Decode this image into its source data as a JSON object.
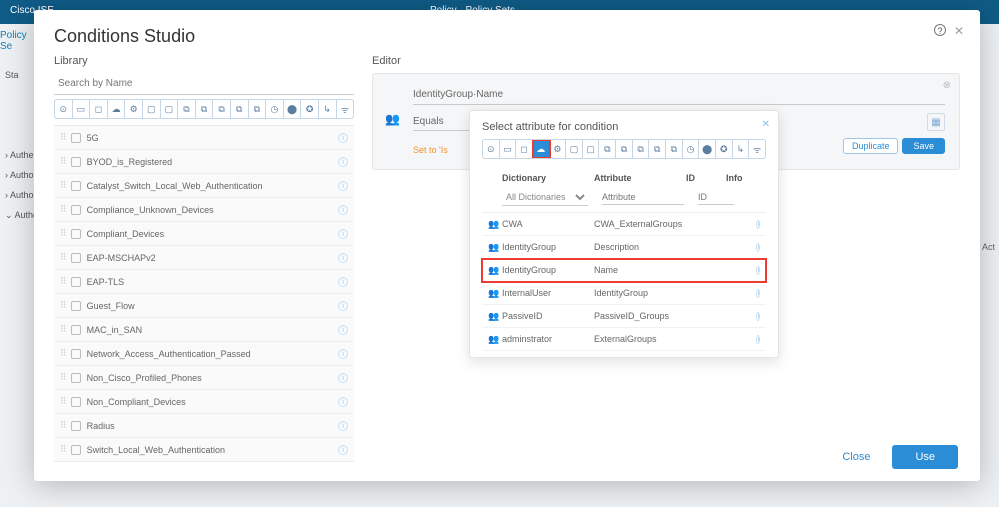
{
  "background": {
    "app": "Cisco ISE",
    "breadcrumb": "Policy · Policy Sets",
    "policy_sets_label": "Policy Se",
    "side_items": [
      "Authe",
      "Autho",
      "Autho",
      "Authori"
    ],
    "status_label": "Sta",
    "actions_label": "Act"
  },
  "modal": {
    "title": "Conditions Studio",
    "help_tooltip": "?",
    "library_label": "Library",
    "editor_label": "Editor",
    "search_placeholder": "Search by Name",
    "close_label": "Close",
    "use_label": "Use"
  },
  "icon_filters": [
    "⊙",
    "▭",
    "◻",
    "☁",
    "⚙",
    "▢",
    "▢",
    "⧉",
    "⧉",
    "⧉",
    "⧉",
    "⧉",
    "◷",
    "⬤",
    "✪",
    "↳",
    "ᯤ"
  ],
  "library_items": [
    {
      "name": "5G"
    },
    {
      "name": "BYOD_is_Registered"
    },
    {
      "name": "Catalyst_Switch_Local_Web_Authentication"
    },
    {
      "name": "Compliance_Unknown_Devices"
    },
    {
      "name": "Compliant_Devices"
    },
    {
      "name": "EAP-MSCHAPv2"
    },
    {
      "name": "EAP-TLS"
    },
    {
      "name": "Guest_Flow"
    },
    {
      "name": "MAC_in_SAN"
    },
    {
      "name": "Network_Access_Authentication_Passed"
    },
    {
      "name": "Non_Cisco_Profiled_Phones"
    },
    {
      "name": "Non_Compliant_Devices"
    },
    {
      "name": "Radius"
    },
    {
      "name": "Switch_Local_Web_Authentication"
    }
  ],
  "editor": {
    "attribute_value": "IdentityGroup·Name",
    "operator": "Equals",
    "set_link": "Set to 'Is",
    "duplicate": "Duplicate",
    "save": "Save"
  },
  "popover": {
    "title": "Select attribute for condition",
    "headers": {
      "dictionary": "Dictionary",
      "attribute": "Attribute",
      "id": "ID",
      "info": "Info"
    },
    "dict_filter": "All Dictionaries",
    "attr_filter_placeholder": "Attribute",
    "id_filter_placeholder": "ID",
    "rows": [
      {
        "dict": "CWA",
        "attr": "CWA_ExternalGroups",
        "highlight": false
      },
      {
        "dict": "IdentityGroup",
        "attr": "Description",
        "highlight": false
      },
      {
        "dict": "IdentityGroup",
        "attr": "Name",
        "highlight": true
      },
      {
        "dict": "InternalUser",
        "attr": "IdentityGroup",
        "highlight": false
      },
      {
        "dict": "PassiveID",
        "attr": "PassiveID_Groups",
        "highlight": false
      },
      {
        "dict": "adminstrator",
        "attr": "ExternalGroups",
        "highlight": false
      }
    ]
  }
}
